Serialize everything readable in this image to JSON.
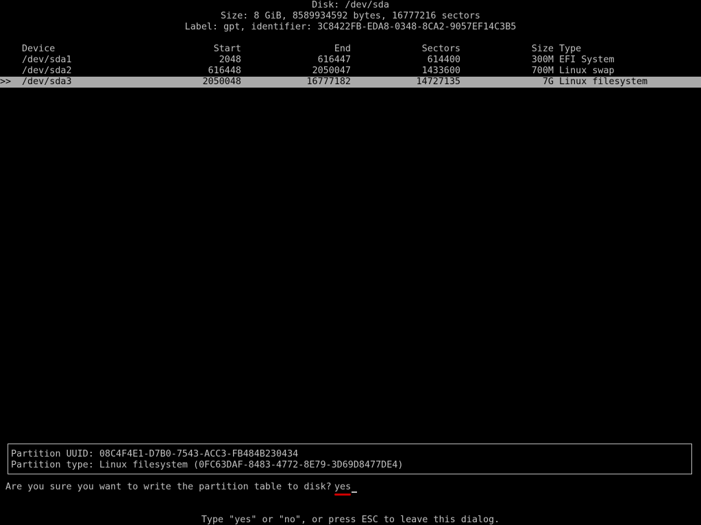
{
  "header": {
    "disk": "Disk: /dev/sda",
    "size": "Size: 8 GiB, 8589934592 bytes, 16777216 sectors",
    "label": "Label: gpt, identifier: 3C8422FB-EDA8-0348-8CA2-9057EF14C3B5"
  },
  "table": {
    "columns": {
      "device": "Device",
      "start": "Start",
      "end": "End",
      "sectors": "Sectors",
      "size": "Size",
      "type": "Type"
    },
    "selected_marker": ">>",
    "rows": [
      {
        "device": "/dev/sda1",
        "start": "2048",
        "end": "616447",
        "sectors": "614400",
        "size": "300M",
        "type": "EFI System"
      },
      {
        "device": "/dev/sda2",
        "start": "616448",
        "end": "2050047",
        "sectors": "1433600",
        "size": "700M",
        "type": "Linux swap"
      },
      {
        "device": "/dev/sda3",
        "start": "2050048",
        "end": "16777182",
        "sectors": "14727135",
        "size": "7G",
        "type": "Linux filesystem"
      }
    ]
  },
  "info": {
    "uuid": "Partition UUID: 08C4F4E1-D7B0-7543-ACC3-FB484B230434",
    "type": "Partition type: Linux filesystem (0FC63DAF-8483-4772-8E79-3D69D8477DE4)"
  },
  "prompt": {
    "question": "Are you sure you want to write the partition table to disk?",
    "answer": "yes",
    "hint": "Type \"yes\" or \"no\", or press ESC to leave this dialog."
  },
  "colors": {
    "background": "#000000",
    "text": "#c0c0c0",
    "highlight": "#aaaaaa",
    "underline": "#cc0000"
  }
}
